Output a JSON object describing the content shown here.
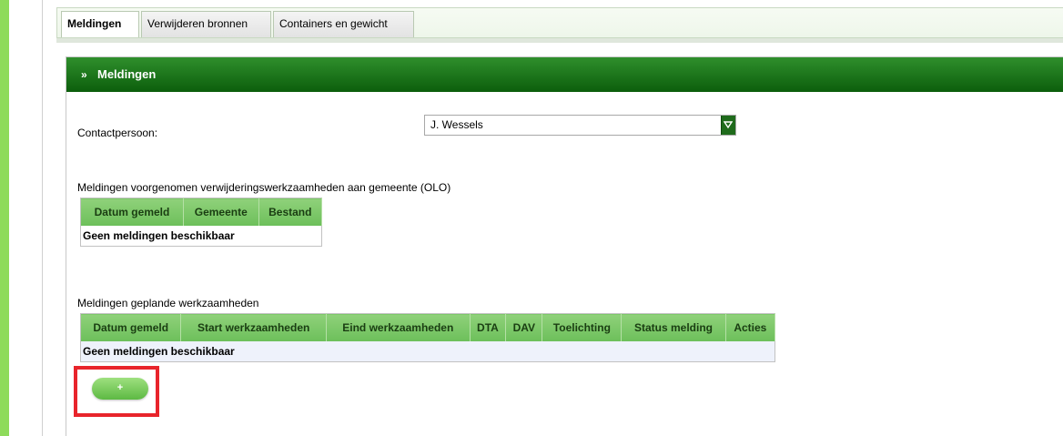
{
  "tabs": [
    {
      "label": "Meldingen",
      "active": true
    },
    {
      "label": "Verwijderen bronnen",
      "active": false
    },
    {
      "label": "Containers en gewicht",
      "active": false
    }
  ],
  "panel": {
    "title": "Meldingen",
    "contact_label": "Contactpersoon:",
    "contact_value": "J. Wessels",
    "section1_label": "Meldingen voorgenomen verwijderingswerkzaamheden aan gemeente (OLO)",
    "table1": {
      "headers": [
        "Datum gemeld",
        "Gemeente",
        "Bestand"
      ],
      "empty_text": "Geen meldingen beschikbaar"
    },
    "section2_label": "Meldingen geplande werkzaamheden",
    "table2": {
      "headers": [
        "Datum gemeld",
        "Start werkzaamheden",
        "Eind werkzaamheden",
        "DTA",
        "DAV",
        "Toelichting",
        "Status melding",
        "Acties"
      ],
      "empty_text": "Geen meldingen beschikbaar"
    },
    "add_button_label": "+"
  },
  "colors": {
    "header_green": "#0c5e0c",
    "table_header_green": "#6cbf5a",
    "left_accent": "#8edb5b",
    "highlight_red": "#e8242b"
  }
}
